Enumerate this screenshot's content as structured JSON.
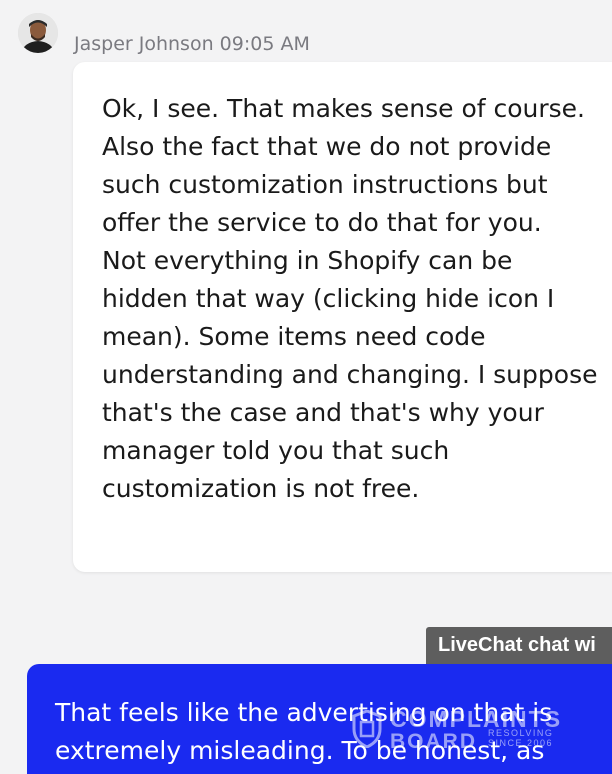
{
  "message_in": {
    "sender": "Jasper Johnson",
    "time": "09:05 AM",
    "text": "Ok, I see. That makes sense of course. Also the fact that we do not provide such customization instructions but offer the service to do that for you.\nNot everything in Shopify can be hidden that way (clicking hide icon I mean). Some items need code understanding and changing. I suppose that's the case and that's why your manager told you that such customization is not free."
  },
  "livechat_tag": {
    "label": "LiveChat chat wi"
  },
  "message_out": {
    "text": "That feels like the advertising on that is extremely misleading. To be honest, as"
  },
  "watermark": {
    "line1": "COMPLAINTS",
    "line2": "BOARD",
    "side_text": "RESOLVING\nSINCE 2006"
  },
  "colors": {
    "background": "#f3f3f4",
    "incoming_bubble": "#ffffff",
    "outgoing_bubble": "#1a2af0",
    "livechat_tag": "#5e5e5e"
  },
  "icons": {
    "avatar": "user-avatar-photo",
    "watermark_logo": "shield-logo-icon"
  }
}
